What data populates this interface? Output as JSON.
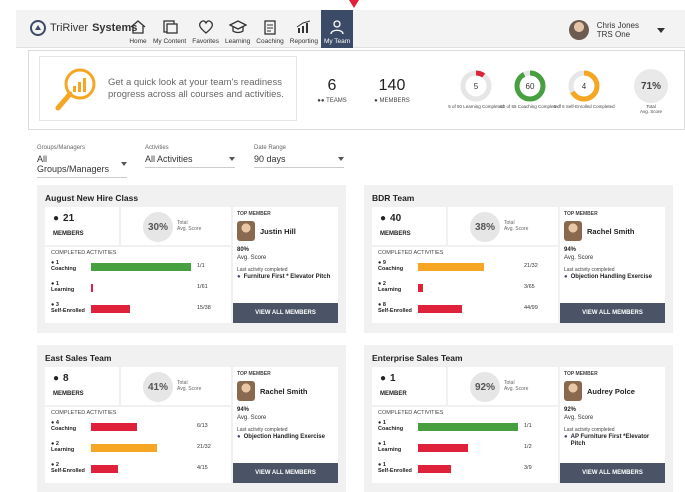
{
  "app": {
    "brand": "TriRiverSystems",
    "brand_a": "TriRiver",
    "brand_b": "Systems"
  },
  "nav": [
    {
      "label": "Home",
      "icon": "home-icon"
    },
    {
      "label": "My Content",
      "icon": "content-icon"
    },
    {
      "label": "Favorites",
      "icon": "heart-icon"
    },
    {
      "label": "Learning",
      "icon": "graduation-cap-icon"
    },
    {
      "label": "Coaching",
      "icon": "clipboard-icon"
    },
    {
      "label": "Reporting",
      "icon": "chart-icon"
    },
    {
      "label": "My Team",
      "icon": "team-icon",
      "active": true
    }
  ],
  "user": {
    "name": "Chris Jones",
    "org": "TRS One"
  },
  "summary": {
    "intro": "Get a quick look at your team's readiness progress across all courses and activities.",
    "teams_num": "6",
    "teams_label": "TEAMS",
    "members_num": "140",
    "members_label": "MEMBERS",
    "rings": [
      {
        "value": "5",
        "caption": "5 of 50 Learning Completed",
        "color": "#e0213a",
        "fraction": 0.1
      },
      {
        "value": "60",
        "caption": "60 of 65 Coaching Completed",
        "color": "#46a040",
        "fraction": 0.92
      },
      {
        "value": "4",
        "caption": "4 of 6 Self-Enrolled Completed",
        "color": "#f5a623",
        "fraction": 0.67
      }
    ],
    "total_pct": "71%",
    "total_label_1": "Total",
    "total_label_2": "Avg. Score"
  },
  "filters": [
    {
      "label": "Groups/Managers",
      "value": "All Groups/Managers"
    },
    {
      "label": "Activities",
      "value": "All Activities"
    },
    {
      "label": "Date Range",
      "value": "90 days"
    }
  ],
  "labels": {
    "completed": "COMPLETED ACTIVITIES",
    "top_member": "TOP MEMBER",
    "avg": "Avg. Score",
    "last": "Last activity completed",
    "view_all": "VIEW ALL MEMBERS",
    "total": "Total",
    "avg_score": "Avg. Score"
  },
  "teams": [
    {
      "name": "August New Hire Class",
      "members": "21",
      "members_label": "MEMBERS",
      "score": "30%",
      "activities": [
        {
          "num": "1",
          "label": "Coaching",
          "count": "1/1",
          "fraction": 1.0,
          "color": "#46a040"
        },
        {
          "num": "1",
          "label": "Learning",
          "count": "1/61",
          "fraction": 0.02,
          "color": "#e0213a"
        },
        {
          "num": "3",
          "label": "Self-Enrolled",
          "count": "15/38",
          "fraction": 0.39,
          "color": "#e0213a"
        }
      ],
      "top": {
        "name": "Justin Hill",
        "pct": "80%",
        "course": "Furniture First * Elevator Pitch"
      }
    },
    {
      "name": "BDR Team",
      "members": "40",
      "members_label": "MEMBERS",
      "score": "38%",
      "activities": [
        {
          "num": "9",
          "label": "Coaching",
          "count": "21/32",
          "fraction": 0.66,
          "color": "#f5a623"
        },
        {
          "num": "2",
          "label": "Learning",
          "count": "3/65",
          "fraction": 0.05,
          "color": "#e0213a"
        },
        {
          "num": "8",
          "label": "Self-Enrolled",
          "count": "44/99",
          "fraction": 0.44,
          "color": "#e0213a"
        }
      ],
      "top": {
        "name": "Rachel Smith",
        "pct": "94%",
        "course": "Objection Handling Exercise"
      }
    },
    {
      "name": "East Sales Team",
      "members": "8",
      "members_label": "MEMBERS",
      "score": "41%",
      "activities": [
        {
          "num": "4",
          "label": "Coaching",
          "count": "6/13",
          "fraction": 0.46,
          "color": "#e0213a"
        },
        {
          "num": "2",
          "label": "Learning",
          "count": "21/32",
          "fraction": 0.66,
          "color": "#f5a623"
        },
        {
          "num": "2",
          "label": "Self-Enrolled",
          "count": "4/15",
          "fraction": 0.27,
          "color": "#e0213a"
        }
      ],
      "top": {
        "name": "Rachel Smith",
        "pct": "94%",
        "course": "Objection Handling Exercise"
      }
    },
    {
      "name": "Enterprise Sales Team",
      "members": "1",
      "members_label": "MEMBER",
      "score": "92%",
      "activities": [
        {
          "num": "1",
          "label": "Coaching",
          "count": "1/1",
          "fraction": 1.0,
          "color": "#46a040"
        },
        {
          "num": "1",
          "label": "Learning",
          "count": "1/2",
          "fraction": 0.5,
          "color": "#e0213a"
        },
        {
          "num": "1",
          "label": "Self-Enrolled",
          "count": "3/9",
          "fraction": 0.33,
          "color": "#e0213a"
        }
      ],
      "top": {
        "name": "Audrey Polce",
        "pct": "92%",
        "course": "AP Furniture First *Elevator Pitch"
      }
    }
  ]
}
